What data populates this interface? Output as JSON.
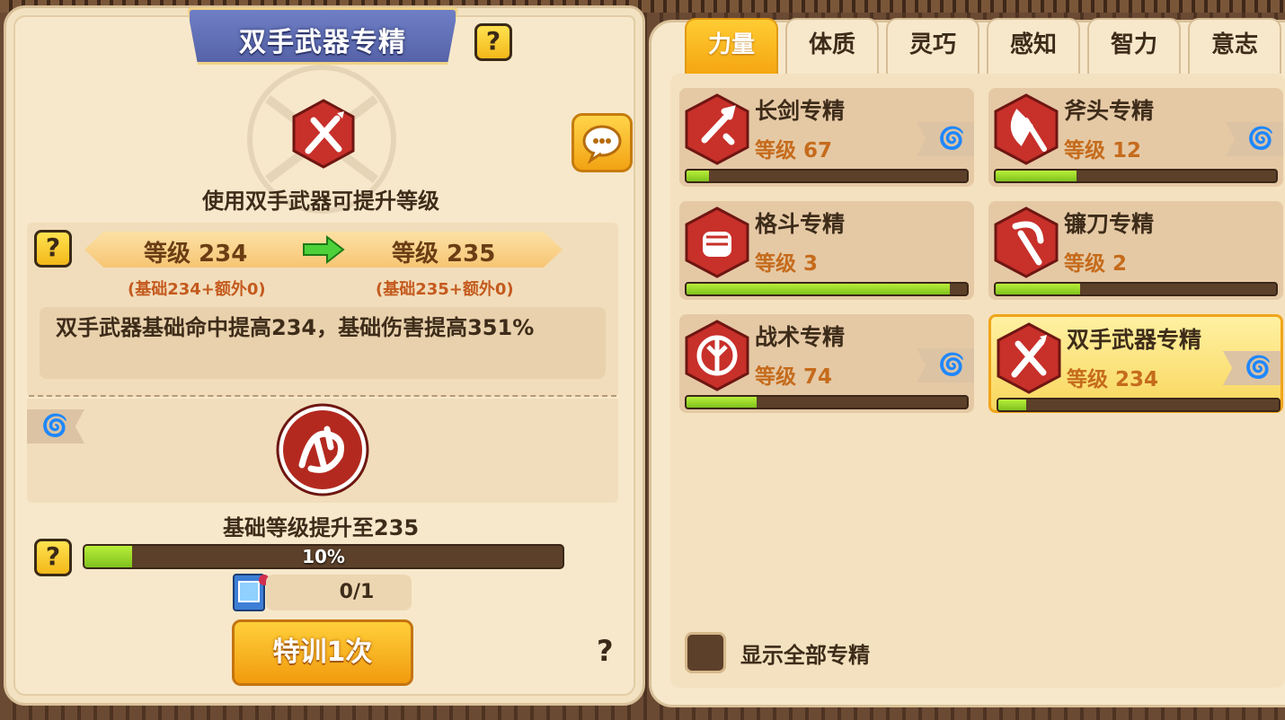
{
  "detail": {
    "title": "双手武器专精",
    "description": "使用双手武器可提升等级",
    "current_level": "等级 234",
    "next_level": "等级 235",
    "current_breakdown": "(基础234+额外0)",
    "next_breakdown": "(基础235+额外0)",
    "effect": "双手武器基础命中提高234，基础伤害提高351%",
    "upgrade_text": "基础等级提升至235",
    "progress": {
      "value": 0.1,
      "label": "10%"
    },
    "item_count": "0/1",
    "train_button": "特训1次",
    "help": "?",
    "question": "?"
  },
  "tabs": [
    {
      "label": "力量",
      "active": true
    },
    {
      "label": "体质",
      "active": false
    },
    {
      "label": "灵巧",
      "active": false
    },
    {
      "label": "感知",
      "active": false
    },
    {
      "label": "智力",
      "active": false
    },
    {
      "label": "意志",
      "active": false
    }
  ],
  "skills": [
    {
      "name": "长剑专精",
      "level": "等级 67",
      "progress": 0.08,
      "icon": "sword-icon",
      "swirl": true,
      "selected": false
    },
    {
      "name": "斧头专精",
      "level": "等级 12",
      "progress": 0.29,
      "icon": "axe-icon",
      "swirl": true,
      "selected": false
    },
    {
      "name": "格斗专精",
      "level": "等级 3",
      "progress": 0.94,
      "icon": "fist-icon",
      "swirl": false,
      "selected": false
    },
    {
      "name": "镰刀专精",
      "level": "等级 2",
      "progress": 0.3,
      "icon": "scythe-icon",
      "swirl": false,
      "selected": false
    },
    {
      "name": "战术专精",
      "level": "等级 74",
      "progress": 0.25,
      "icon": "tactics-icon",
      "swirl": true,
      "selected": false
    },
    {
      "name": "双手武器专精",
      "level": "等级 234",
      "progress": 0.1,
      "icon": "two-hand-weapon-icon",
      "swirl": true,
      "selected": true
    }
  ],
  "show_all_label": "显示全部专精",
  "colors": {
    "accent": "#f5a611",
    "bar": "#7fc21d",
    "hex": "#c8302a"
  }
}
